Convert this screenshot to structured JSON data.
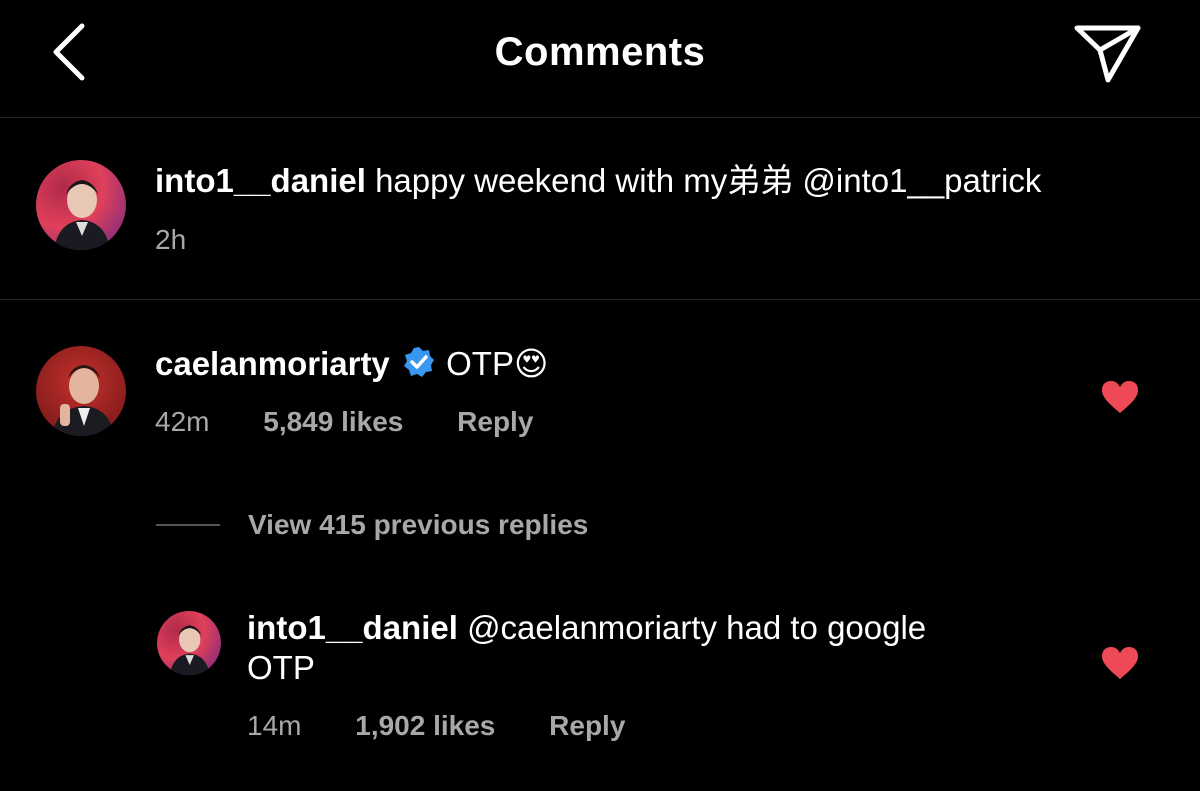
{
  "header": {
    "title": "Comments",
    "back_icon": "chevron-left-icon",
    "send_icon": "paper-plane-icon"
  },
  "caption": {
    "username": "into1__daniel",
    "text": "happy weekend with my弟弟 @into1__patrick",
    "time": "2h"
  },
  "comments": [
    {
      "username": "caelanmoriarty",
      "verified": true,
      "text": "OTP",
      "emoji": "😍",
      "time": "42m",
      "likes": "5,849 likes",
      "reply_label": "Reply",
      "liked": true
    }
  ],
  "view_replies_label": "View 415 previous replies",
  "replies": [
    {
      "username": "into1__daniel",
      "text_line1": "@caelanmoriarty had to google",
      "text_line2": "OTP",
      "time": "14m",
      "likes": "1,902 likes",
      "reply_label": "Reply",
      "liked": true
    }
  ],
  "colors": {
    "background": "#000000",
    "heart": "#ed4956",
    "verified": "#3897f0",
    "secondary_text": "#a8a8a8",
    "divider": "#262626"
  }
}
